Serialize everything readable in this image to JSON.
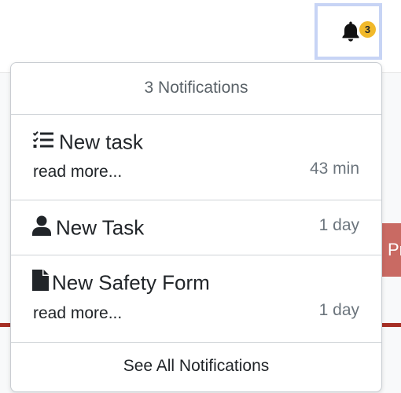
{
  "topbar": {
    "notification_count": "3",
    "bell_icon": "bell-icon"
  },
  "background": {
    "side_button_label": "Pr"
  },
  "dropdown": {
    "header": "3 Notifications",
    "items": [
      {
        "icon": "tasks-icon",
        "title": "New task",
        "more": "read more...",
        "time": "43 min"
      },
      {
        "icon": "user-icon",
        "title": "New Task",
        "time": "1 day"
      },
      {
        "icon": "file-icon",
        "title": "New Safety Form",
        "more": "read more...",
        "time": "1 day"
      }
    ],
    "footer": "See All Notifications"
  },
  "colors": {
    "badge": "#f1b92b",
    "focus_ring": "#c7d4f5",
    "side_button": "#c96a63",
    "rule": "#a62f25"
  }
}
